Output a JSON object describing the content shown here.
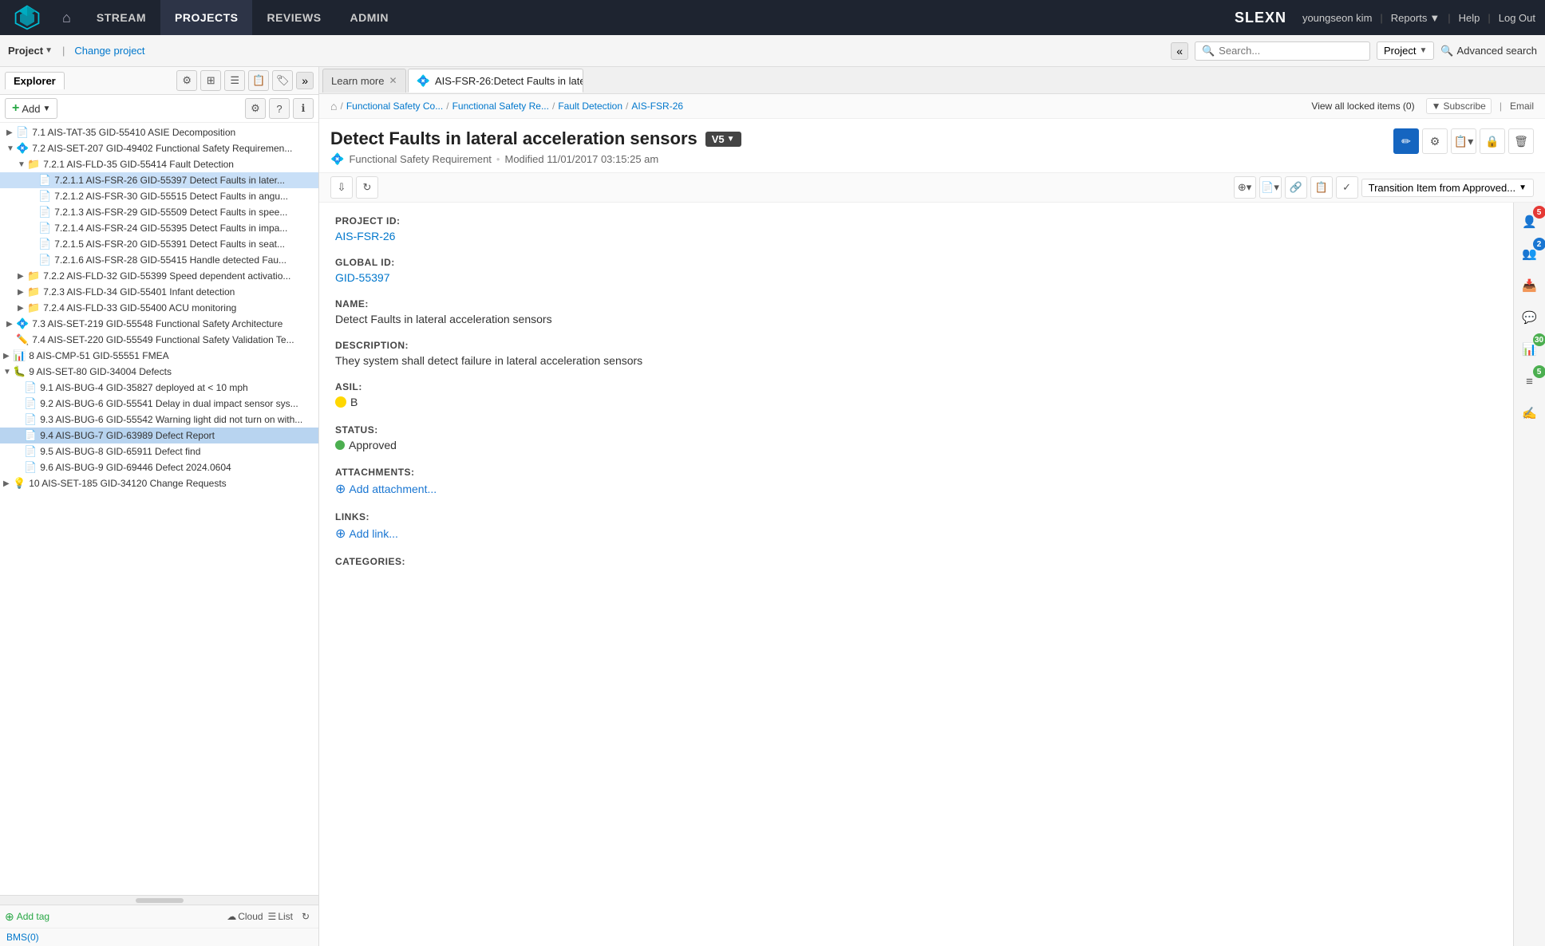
{
  "app": {
    "name": "SLEXN",
    "logo_alt": "Polarion logo"
  },
  "nav": {
    "home_icon": "🏠",
    "items": [
      {
        "label": "STREAM",
        "active": false
      },
      {
        "label": "PROJECTS",
        "active": true
      },
      {
        "label": "REVIEWS",
        "active": false
      },
      {
        "label": "ADMIN",
        "active": false
      }
    ],
    "user": "youngseon kim",
    "reports": "Reports",
    "help": "Help",
    "logout": "Log Out"
  },
  "second_bar": {
    "project_label": "Project",
    "change_project": "Change project",
    "search_placeholder": "Search...",
    "project_selector": "Project",
    "advanced_search": "Advanced search"
  },
  "left_panel": {
    "tab": "Explorer",
    "add_label": "Add",
    "bms": "BMS(0)",
    "add_tag": "Add tag",
    "cloud_label": "Cloud",
    "list_label": "List",
    "tree_items": [
      {
        "id": "t1",
        "text": "7.1 AIS-TAT-35 GID-55410 ASIE Decomposition",
        "level": 1,
        "toggle": "▶",
        "icon": "📄"
      },
      {
        "id": "t2",
        "text": "7.2 AIS-SET-207 GID-49402 Functional Safety Requiremen...",
        "level": 1,
        "toggle": "▼",
        "icon": "💠"
      },
      {
        "id": "t3",
        "text": "7.2.1 AIS-FLD-35 GID-55414 Fault Detection",
        "level": 2,
        "toggle": "▼",
        "icon": "📁"
      },
      {
        "id": "t4",
        "text": "7.2.1.1 AIS-FSR-26 GID-55397 Detect Faults in later...",
        "level": 3,
        "toggle": "",
        "icon": "📄",
        "selected": true
      },
      {
        "id": "t5",
        "text": "7.2.1.2 AIS-FSR-30 GID-55515 Detect Faults in angu...",
        "level": 3,
        "toggle": "",
        "icon": "📄"
      },
      {
        "id": "t6",
        "text": "7.2.1.3 AIS-FSR-29 GID-55509 Detect Faults in spee...",
        "level": 3,
        "toggle": "",
        "icon": "📄"
      },
      {
        "id": "t7",
        "text": "7.2.1.4 AIS-FSR-24 GID-55395 Detect Faults in impa...",
        "level": 3,
        "toggle": "",
        "icon": "📄"
      },
      {
        "id": "t8",
        "text": "7.2.1.5 AIS-FSR-20 GID-55391 Detect Faults in seat...",
        "level": 3,
        "toggle": "",
        "icon": "📄"
      },
      {
        "id": "t9",
        "text": "7.2.1.6 AIS-FSR-28 GID-55415 Handle detected Fau...",
        "level": 3,
        "toggle": "",
        "icon": "📄"
      },
      {
        "id": "t10",
        "text": "7.2.2 AIS-FLD-32 GID-55399 Speed dependent activatio...",
        "level": 2,
        "toggle": "▶",
        "icon": "📁"
      },
      {
        "id": "t11",
        "text": "7.2.3 AIS-FLD-34 GID-55401 Infant detection",
        "level": 2,
        "toggle": "▶",
        "icon": "📁"
      },
      {
        "id": "t12",
        "text": "7.2.4 AIS-FLD-33 GID-55400 ACU monitoring",
        "level": 2,
        "toggle": "▶",
        "icon": "📁"
      },
      {
        "id": "t13",
        "text": "7.3 AIS-SET-219 GID-55548 Functional Safety Architecture",
        "level": 1,
        "toggle": "▶",
        "icon": "💠"
      },
      {
        "id": "t14",
        "text": "7.4 AIS-SET-220 GID-55549 Functional Safety Validation Te...",
        "level": 1,
        "toggle": "",
        "icon": "✏️"
      },
      {
        "id": "t15",
        "text": "8 AIS-CMP-51 GID-55551 FMEA",
        "level": 0,
        "toggle": "▶",
        "icon": "📊"
      },
      {
        "id": "t16",
        "text": "9 AIS-SET-80 GID-34004 Defects",
        "level": 0,
        "toggle": "▼",
        "icon": "🐛"
      },
      {
        "id": "t17",
        "text": "9.1 AIS-BUG-4 GID-35827 deployed at < 10 mph",
        "level": 1,
        "toggle": "",
        "icon": "📄"
      },
      {
        "id": "t18",
        "text": "9.2 AIS-BUG-6 GID-55541 Delay in dual impact sensor sys...",
        "level": 1,
        "toggle": "",
        "icon": "📄"
      },
      {
        "id": "t19",
        "text": "9.3 AIS-BUG-6 GID-55542 Warning light did not turn on with...",
        "level": 1,
        "toggle": "",
        "icon": "📄"
      },
      {
        "id": "t20",
        "text": "9.4 AIS-BUG-7 GID-63989 Defect Report",
        "level": 1,
        "toggle": "",
        "icon": "📄",
        "highlighted": true
      },
      {
        "id": "t21",
        "text": "9.5 AIS-BUG-8 GID-65911 Defect find",
        "level": 1,
        "toggle": "",
        "icon": "📄"
      },
      {
        "id": "t22",
        "text": "9.6 AIS-BUG-9 GID-69446 Defect 2024.0604",
        "level": 1,
        "toggle": "",
        "icon": "📄"
      },
      {
        "id": "t23",
        "text": "10 AIS-SET-185 GID-34120 Change Requests",
        "level": 0,
        "toggle": "▶",
        "icon": "💡"
      }
    ]
  },
  "tabs": [
    {
      "label": "Learn more",
      "active": false,
      "icon": ""
    },
    {
      "label": "AIS-FSR-26:Detect Faults in late...",
      "active": true,
      "icon": "💠"
    }
  ],
  "breadcrumb": {
    "items": [
      "Functional Safety Co...",
      "Functional Safety Re...",
      "Fault Detection",
      "AIS-FSR-26"
    ],
    "view_locked": "View all locked items (0)",
    "subscribe": "Subscribe",
    "email": "Email"
  },
  "item": {
    "title": "Detect Faults in lateral acceleration sensors",
    "version": "V5",
    "item_type": "Functional Safety Requirement",
    "modified": "Modified 11/01/2017 03:15:25 am",
    "project_id_label": "PROJECT ID:",
    "project_id_value": "AIS-FSR-26",
    "global_id_label": "GLOBAL ID:",
    "global_id_value": "GID-55397",
    "name_label": "NAME:",
    "name_value": "Detect Faults in lateral acceleration sensors",
    "description_label": "DESCRIPTION:",
    "description_value": "They system shall detect failure in lateral acceleration sensors",
    "asil_label": "ASIL:",
    "asil_value": "B",
    "status_label": "STATUS:",
    "status_value": "Approved",
    "attachments_label": "ATTACHMENTS:",
    "add_attachment": "Add attachment...",
    "links_label": "LINKS:",
    "add_link": "Add link...",
    "categories_label": "CATEGORIES:",
    "transition_label": "Transition Item from Approved..."
  },
  "right_sidebar": {
    "badge1": "5",
    "badge2": "2",
    "badge3": "5",
    "badge4": "30"
  }
}
